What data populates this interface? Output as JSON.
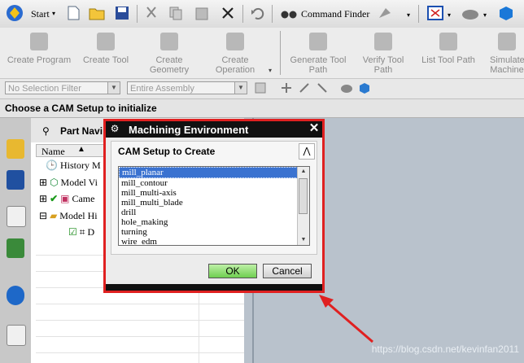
{
  "toolbar": {
    "start_label": "Start",
    "command_finder_label": "Command Finder"
  },
  "cam_toolbar": {
    "buttons": [
      {
        "label": "Create Program"
      },
      {
        "label": "Create Tool"
      },
      {
        "label": "Create Geometry"
      },
      {
        "label": "Create Operation"
      },
      {
        "label": "Generate Tool Path"
      },
      {
        "label": "Verify Tool Path"
      },
      {
        "label": "List Tool Path"
      },
      {
        "label": "Simulate Machine"
      }
    ]
  },
  "filters": {
    "selection_filter": "No Selection Filter",
    "scope": "Entire Assembly"
  },
  "status_bar": {
    "prompt": "Choose a CAM Setup to initialize"
  },
  "navigator": {
    "title": "Part Navi",
    "column_name": "Name",
    "tree": [
      {
        "label": "History M"
      },
      {
        "label": "Model Vi"
      },
      {
        "label": "Came"
      },
      {
        "label": "Model Hi"
      },
      {
        "label": "D"
      }
    ]
  },
  "dialog": {
    "title": "Machining Environment",
    "group_title": "CAM Setup to Create",
    "list_items": [
      "mill_planar",
      "mill_contour",
      "mill_multi-axis",
      "mill_multi_blade",
      "drill",
      "hole_making",
      "turning",
      "wire_edm"
    ],
    "selected_index": 0,
    "ok_label": "OK",
    "cancel_label": "Cancel"
  },
  "watermark": "https://blog.csdn.net/kevinfan2011",
  "colors": {
    "highlight_border": "#e02020",
    "selection": "#3a72d0",
    "ok_button": "#6fcf50"
  }
}
